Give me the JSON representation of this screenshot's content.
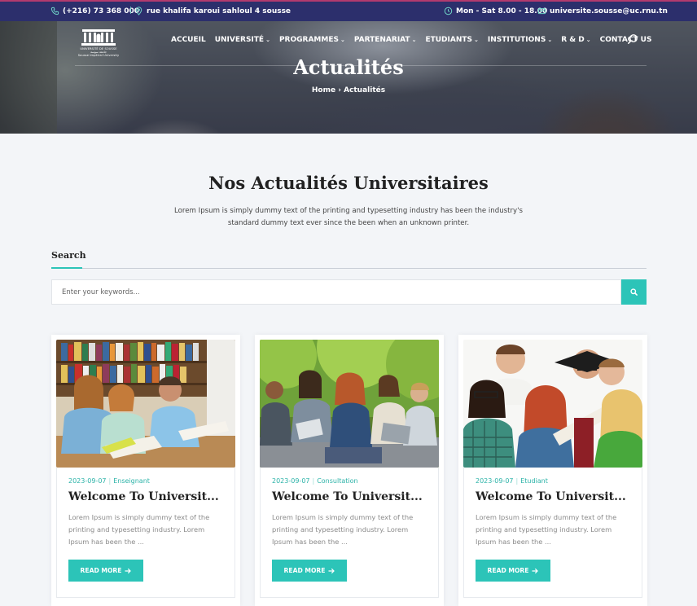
{
  "topbar": {
    "phone": "(+216) 73 368 000",
    "address": "rue khalifa karoui sahloul 4 sousse",
    "hours": "Mon - Sat 8.00 - 18.00",
    "email": "universite.sousse@uc.rnu.tn"
  },
  "logo": {
    "line1": "UNIVERSITÉ DE SOUSSE",
    "line2": "جامعة سوسة",
    "line3": "Sousse Impérial University"
  },
  "nav": [
    {
      "label": "ACCUEIL",
      "has_menu": false
    },
    {
      "label": "UNIVERSITÉ",
      "has_menu": true
    },
    {
      "label": "PROGRAMMES",
      "has_menu": true
    },
    {
      "label": "PARTENARIAT",
      "has_menu": true
    },
    {
      "label": "ETUDIANTS",
      "has_menu": true
    },
    {
      "label": "INSTITUTIONS",
      "has_menu": true
    },
    {
      "label": "R & D",
      "has_menu": true
    },
    {
      "label": "CONTACT US",
      "has_menu": false
    }
  ],
  "hero": {
    "title": "Actualités",
    "breadcrumb_home": "Home",
    "breadcrumb_sep": "›",
    "breadcrumb_current": "Actualités"
  },
  "section": {
    "title": "Nos Actualités Universitaires",
    "description": "Lorem Ipsum is simply dummy text of the printing and typesetting industry has been the industry's standard dummy text ever since the been when an unknown printer."
  },
  "search": {
    "label": "Search",
    "placeholder": "Enter your keywords..."
  },
  "cards": [
    {
      "date": "2023-09-07",
      "category": "Enseignant",
      "title": "Welcome To Universit...",
      "excerpt": "Lorem Ipsum is simply dummy text of the printing and typesetting industry. Lorem Ipsum has been the ...",
      "button": "READ MORE"
    },
    {
      "date": "2023-09-07",
      "category": "Consultation",
      "title": "Welcome To Universit...",
      "excerpt": "Lorem Ipsum is simply dummy text of the printing and typesetting industry. Lorem Ipsum has been the ...",
      "button": "READ MORE"
    },
    {
      "date": "2023-09-07",
      "category": "Etudiant",
      "title": "Welcome To Universit...",
      "excerpt": "Lorem Ipsum is simply dummy text of the printing and typesetting industry. Lorem Ipsum has been the ...",
      "button": "READ MORE"
    }
  ],
  "colors": {
    "topbar": "#2c2f6c",
    "accent": "#2cc4b8",
    "heading": "#222222"
  }
}
